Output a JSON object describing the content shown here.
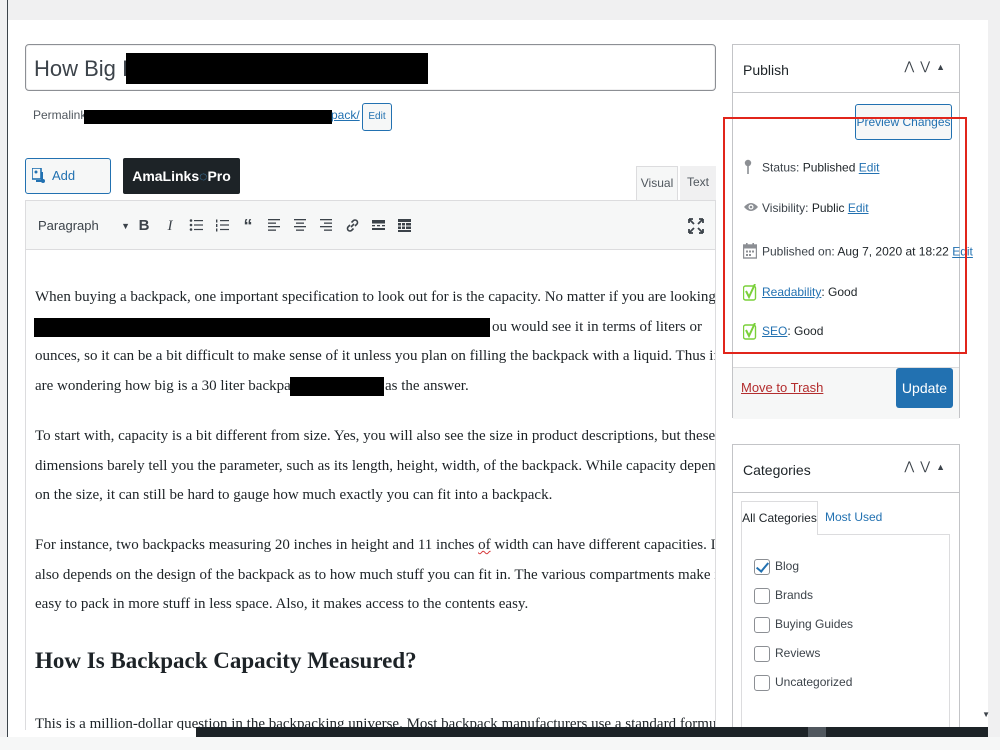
{
  "editor": {
    "title": "How Big Is a",
    "permalink_label": "Permalink:",
    "permalink_tail": "pack/",
    "permalink_edit": "Edit",
    "add_media": "Add Media",
    "amalinks_a": "AmaLinks",
    "amalinks_b": "Pro",
    "tabs": {
      "visual": "Visual",
      "text": "Text"
    },
    "format_select": "Paragraph",
    "paragraphs": [
      [
        "When buying a backpack, one important specification to look out for is the capacity. No matter if you are looking for",
        "ou would see it in terms of liters or",
        "ounces, so it can be a bit difficult to make sense of it unless you plan on filling the backpack with a liquid. Thus if you",
        "are wondering how big is a 30 liter backpack,",
        "as the answer."
      ],
      [
        "To start with, capacity is a bit different from size. Yes, you will also see the size in product descriptions, but these",
        "dimensions barely tell you the parameter, such as its length, height, width, of the backpack. While capacity depends",
        "on the size, it can still be hard to gauge how much exactly you can fit into a backpack."
      ],
      [
        "For instance, two backpacks measuring 20 inches in height and 11 inches",
        "of",
        "width can have different capacities. It",
        "also depends on the design of the backpack as to how much stuff you can fit in. The various compartments make it",
        "easy to pack in more stuff in less space. Also, it makes access to the contents easy."
      ]
    ],
    "heading": "How Is Backpack Capacity Measured?",
    "last_line": "This is a million-dollar question in the backpacking universe. Most backpack manufacturers use a standard formula"
  },
  "publish": {
    "title": "Publish",
    "preview": "Preview Changes",
    "status_label": "Status:",
    "status_value": "Published",
    "visibility_label": "Visibility:",
    "visibility_value": "Public",
    "published_label": "Published on:",
    "published_value": "Aug 7, 2020 at 18:22",
    "edit": "Edit",
    "readability_link": "Readability",
    "readability_value": ": Good",
    "seo_link": "SEO",
    "seo_value": ": Good",
    "trash": "Move to Trash",
    "update": "Update"
  },
  "categories": {
    "title": "Categories",
    "tab_all": "All Categories",
    "tab_used": "Most Used",
    "items": [
      {
        "label": "Blog",
        "checked": true
      },
      {
        "label": "Brands",
        "checked": false
      },
      {
        "label": "Buying Guides",
        "checked": false
      },
      {
        "label": "Reviews",
        "checked": false
      },
      {
        "label": "Uncategorized",
        "checked": false
      }
    ]
  },
  "colors": {
    "accent": "#2271b1",
    "danger": "#b32d2e",
    "highlight": "#e1251b",
    "yoast_green": "#7ad03a"
  }
}
